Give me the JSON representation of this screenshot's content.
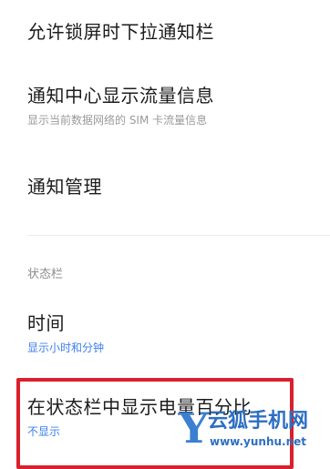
{
  "settings": {
    "items": [
      {
        "title": "允许锁屏时下拉通知栏"
      },
      {
        "title": "通知中心显示流量信息",
        "subtitle": "显示当前数据网络的 SIM 卡流量信息"
      },
      {
        "title": "通知管理"
      }
    ],
    "section_header": "状态栏",
    "status_items": [
      {
        "title": "时间",
        "subtitle": "显示小时和分钟"
      },
      {
        "title": "在状态栏中显示电量百分比",
        "subtitle": "不显示"
      }
    ]
  },
  "watermark": {
    "letter": "Y",
    "name": "云狐手机网",
    "url": "www.yunhu.net"
  },
  "colors": {
    "accent_blue": "#3d7ff0",
    "highlight_red": "#d9202c",
    "subtitle_gray": "#9a9a9a"
  }
}
